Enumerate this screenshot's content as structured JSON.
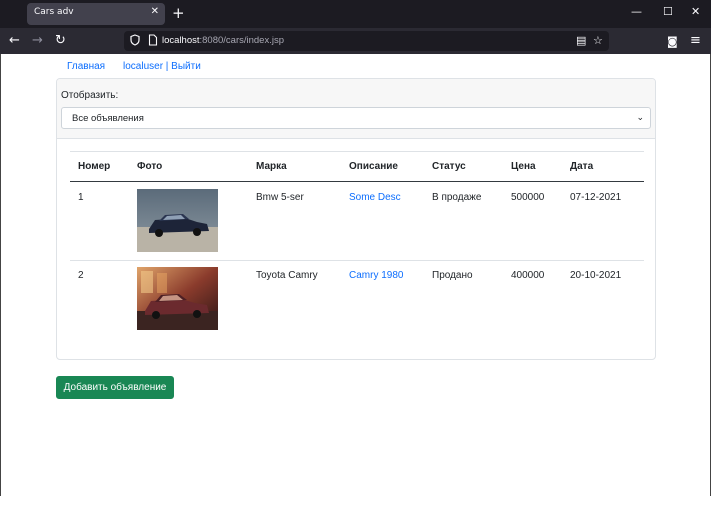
{
  "browser": {
    "tab_title": "Cars adv",
    "tab_close": "✕",
    "new_tab": "+",
    "url_host": "localhost",
    "url_rest": ":8080/cars/index.jsp",
    "win_min": "—",
    "win_max": "☐",
    "win_close": "✕",
    "back": "←",
    "forward": "→",
    "reload": "↻",
    "reader": "▤",
    "bookmark": "☆",
    "pocket": "◙",
    "menu": "≡"
  },
  "nav": {
    "home": "Главная",
    "user": "localuser | Выйти"
  },
  "filter": {
    "label": "Отобразить:",
    "selected": "Все объявления",
    "arrow": "⌄"
  },
  "table": {
    "headers": [
      "Номер",
      "Фото",
      "Марка",
      "Описание",
      "Статус",
      "Цена",
      "Дата"
    ],
    "rows": [
      {
        "num": "1",
        "photo": "car-photo-bmw",
        "brand": "Bmw 5-ser",
        "desc": "Some Desc",
        "status": "В продаже",
        "price": "500000",
        "date": "07-12-2021"
      },
      {
        "num": "2",
        "photo": "car-photo-camry",
        "brand": "Toyota Camry",
        "desc": "Camry 1980",
        "status": "Продано",
        "price": "400000",
        "date": "20-10-2021"
      }
    ]
  },
  "actions": {
    "add": "Добавить объявление"
  },
  "colors": {
    "link": "#0d6efd",
    "button_green": "#198754",
    "browser_dark": "#1c1b22"
  }
}
